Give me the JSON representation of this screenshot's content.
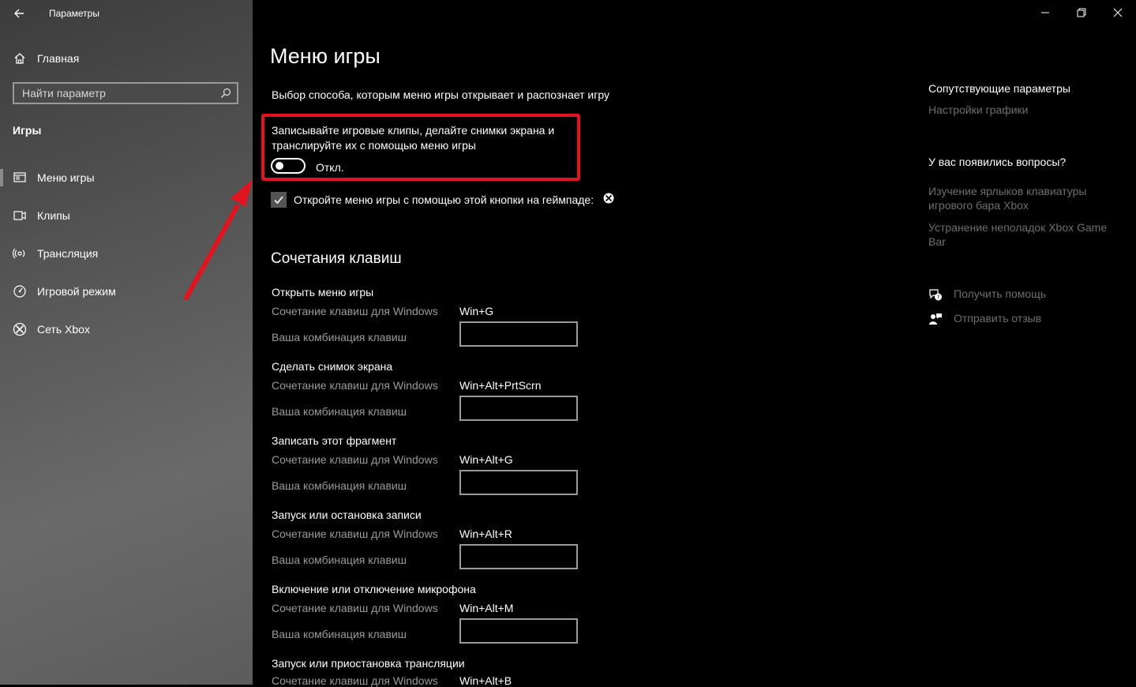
{
  "window": {
    "title": "Параметры",
    "back_icon": "arrow-left-icon",
    "controls": [
      "minimize-icon",
      "restore-icon",
      "close-icon"
    ]
  },
  "sidebar": {
    "home_label": "Главная",
    "search_placeholder": "Найти параметр",
    "section_label": "Игры",
    "items": [
      {
        "label": "Меню игры",
        "icon": "game-bar-icon",
        "active": true
      },
      {
        "label": "Клипы",
        "icon": "clips-icon"
      },
      {
        "label": "Трансляция",
        "icon": "broadcast-icon"
      },
      {
        "label": "Игровой режим",
        "icon": "game-mode-icon"
      },
      {
        "label": "Сеть Xbox",
        "icon": "xbox-icon"
      }
    ]
  },
  "main": {
    "title": "Меню игры",
    "description": "Выбор способа, которым меню игры открывает и распознает игру",
    "toggle": {
      "label": "Записывайте игровые клипы, делайте снимки экрана и транслируйте их с помощью меню игры",
      "state_label": "Откл.",
      "on": false
    },
    "checkbox": {
      "label": "Откройте меню игры с помощью этой кнопки на геймпаде:",
      "checked": true,
      "icon": "xbox-icon"
    },
    "shortcuts_title": "Сочетания клавиш",
    "win_label": "Сочетание клавиш для Windows",
    "custom_label": "Ваша комбинация клавиш",
    "shortcuts": [
      {
        "title": "Открыть меню игры",
        "win": "Win+G",
        "custom": ""
      },
      {
        "title": "Сделать снимок экрана",
        "win": "Win+Alt+PrtScrn",
        "custom": ""
      },
      {
        "title": "Записать этот фрагмент",
        "win": "Win+Alt+G",
        "custom": ""
      },
      {
        "title": "Запуск или остановка записи",
        "win": "Win+Alt+R",
        "custom": ""
      },
      {
        "title": "Включение или отключение микрофона",
        "win": "Win+Alt+M",
        "custom": ""
      },
      {
        "title": "Запуск или приостановка трансляции",
        "win": "Win+Alt+B",
        "custom": ""
      }
    ]
  },
  "right": {
    "related_title": "Сопутствующие параметры",
    "related_link": "Настройки графики",
    "questions_title": "У вас появились вопросы?",
    "question_links": [
      "Изучение ярлыков клавиатуры игрового бара Xbox",
      "Устранение неполадок Xbox Game Bar"
    ],
    "help_label": "Получить помощь",
    "feedback_label": "Отправить отзыв"
  },
  "colors": {
    "highlight": "#e0141e",
    "accent_dim": "#6e6e6e"
  }
}
